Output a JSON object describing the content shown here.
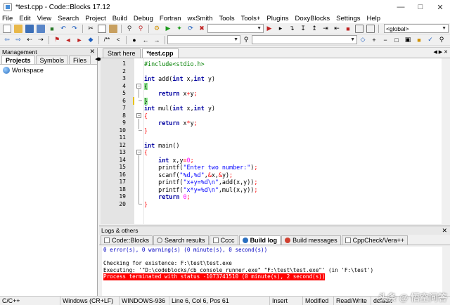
{
  "window": {
    "title": "*test.cpp - Code::Blocks 17.12"
  },
  "menu": [
    "File",
    "Edit",
    "View",
    "Search",
    "Project",
    "Build",
    "Debug",
    "Fortran",
    "wxSmith",
    "Tools",
    "Tools+",
    "Plugins",
    "DoxyBlocks",
    "Settings",
    "Help"
  ],
  "toolbar": {
    "global_scope": "<global>"
  },
  "management": {
    "title": "Management",
    "tabs": [
      "Projects",
      "Symbols",
      "Files"
    ],
    "workspace": "Workspace"
  },
  "editor": {
    "tabs": [
      "Start here",
      "*test.cpp"
    ],
    "line_numbers": [
      "1",
      "2",
      "3",
      "4",
      "5",
      "6",
      "7",
      "8",
      "9",
      "10",
      "11",
      "12",
      "13",
      "14",
      "15",
      "16",
      "17",
      "18",
      "19",
      "20"
    ]
  },
  "logs": {
    "title": "Logs & others",
    "tabs": [
      "Code::Blocks",
      "Search results",
      "Cccc",
      "Build log",
      "Build messages",
      "CppCheck/Vera++"
    ],
    "lines": [
      "0 error(s), 0 warning(s) (0 minute(s), 0 second(s))",
      "",
      "Checking for existence: F:\\test\\test.exe",
      "Executing: '\"D:\\codeblocks/cb_console_runner.exe\" \"F:\\test\\test.exe\"' (in 'F:\\test')",
      "Process terminated with status -1073741510 (0 minute(s), 2 second(s))"
    ]
  },
  "status": {
    "language": "C/C++",
    "eol": "Windows (CR+LF)",
    "encoding": "WINDOWS-936",
    "position": "Line 6, Col 6, Pos 61",
    "mode": "Insert",
    "modified": "Modified",
    "access": "Read/Write",
    "profile": "default"
  },
  "watermark": "头条 @ 悟空问答"
}
